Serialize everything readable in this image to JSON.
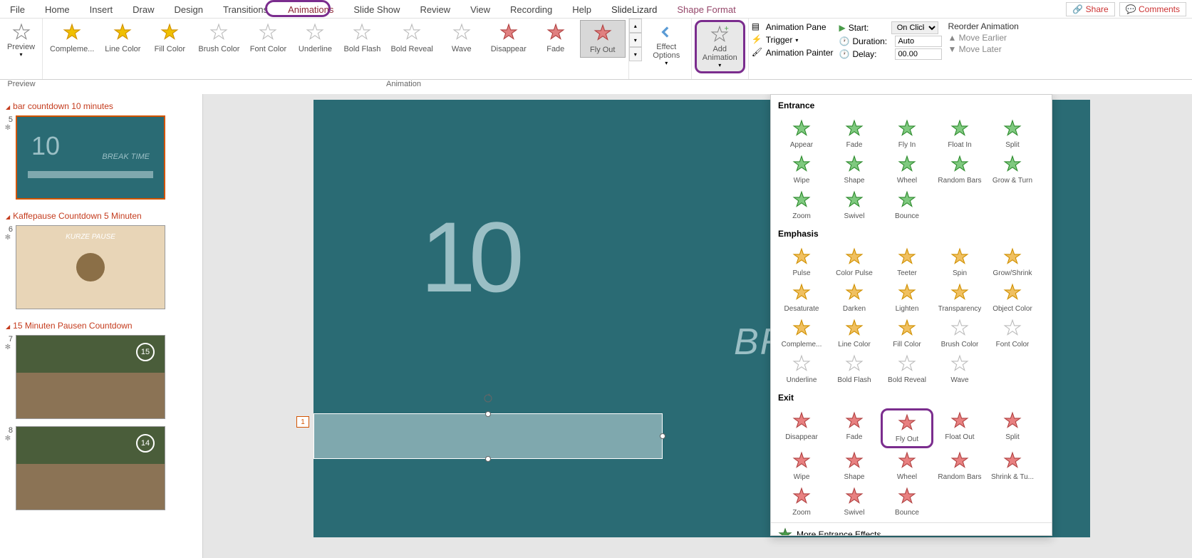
{
  "topbar": {
    "share": "Share",
    "comments": "Comments"
  },
  "tabs": [
    "File",
    "Home",
    "Insert",
    "Draw",
    "Design",
    "Transitions",
    "Animations",
    "Slide Show",
    "Review",
    "View",
    "Recording",
    "Help",
    "SlideLizard",
    "Shape Format"
  ],
  "activeTab": "Animations",
  "preview": {
    "label": "Preview",
    "group": "Preview"
  },
  "gallery": {
    "items": [
      "Compleme...",
      "Line Color",
      "Fill Color",
      "Brush Color",
      "Font Color",
      "Underline",
      "Bold Flash",
      "Bold Reveal",
      "Wave",
      "Disappear",
      "Fade",
      "Fly Out"
    ],
    "selected": "Fly Out",
    "group": "Animation"
  },
  "effectOptions": "Effect Options",
  "addAnimation": "Add Animation",
  "advAnim": {
    "pane": "Animation Pane",
    "trigger": "Trigger",
    "painter": "Animation Painter"
  },
  "timing": {
    "startLabel": "Start:",
    "startVal": "On Click",
    "durationLabel": "Duration:",
    "durationVal": "Auto",
    "delayLabel": "Delay:",
    "delayVal": "00.00"
  },
  "reorder": {
    "title": "Reorder Animation",
    "earlier": "Move Earlier",
    "later": "Move Later"
  },
  "sections": [
    {
      "title": "bar countdown 10 minutes",
      "slides": [
        {
          "num": "5",
          "big": "10",
          "text": "BREAK TIME",
          "active": true
        }
      ]
    },
    {
      "title": "Kaffepause Countdown 5 Minuten",
      "slides": [
        {
          "num": "6",
          "label": "KURZE PAUSE",
          "type": "coffee"
        }
      ]
    },
    {
      "title": "15 Minuten Pausen Countdown",
      "slides": [
        {
          "num": "7",
          "circle": "15",
          "type": "hourglass"
        },
        {
          "num": "8",
          "circle": "14",
          "type": "hourglass"
        }
      ]
    }
  ],
  "canvas": {
    "big": "10",
    "break": "BREAK TIME",
    "animTag": "1"
  },
  "dropdown": {
    "entrance": {
      "title": "Entrance",
      "items": [
        "Appear",
        "Fade",
        "Fly In",
        "Float In",
        "Split",
        "Wipe",
        "Shape",
        "Wheel",
        "Random Bars",
        "Grow & Turn",
        "Zoom",
        "Swivel",
        "Bounce"
      ]
    },
    "emphasis": {
      "title": "Emphasis",
      "items": [
        "Pulse",
        "Color Pulse",
        "Teeter",
        "Spin",
        "Grow/Shrink",
        "Desaturate",
        "Darken",
        "Lighten",
        "Transparency",
        "Object Color",
        "Compleme...",
        "Line Color",
        "Fill Color",
        "Brush Color",
        "Font Color",
        "Underline",
        "Bold Flash",
        "Bold Reveal",
        "Wave"
      ]
    },
    "exit": {
      "title": "Exit",
      "items": [
        "Disappear",
        "Fade",
        "Fly Out",
        "Float Out",
        "Split",
        "Wipe",
        "Shape",
        "Wheel",
        "Random Bars",
        "Shrink & Tu...",
        "Zoom",
        "Swivel",
        "Bounce"
      ],
      "highlight": "Fly Out"
    },
    "more": "More Entrance Effects..."
  }
}
